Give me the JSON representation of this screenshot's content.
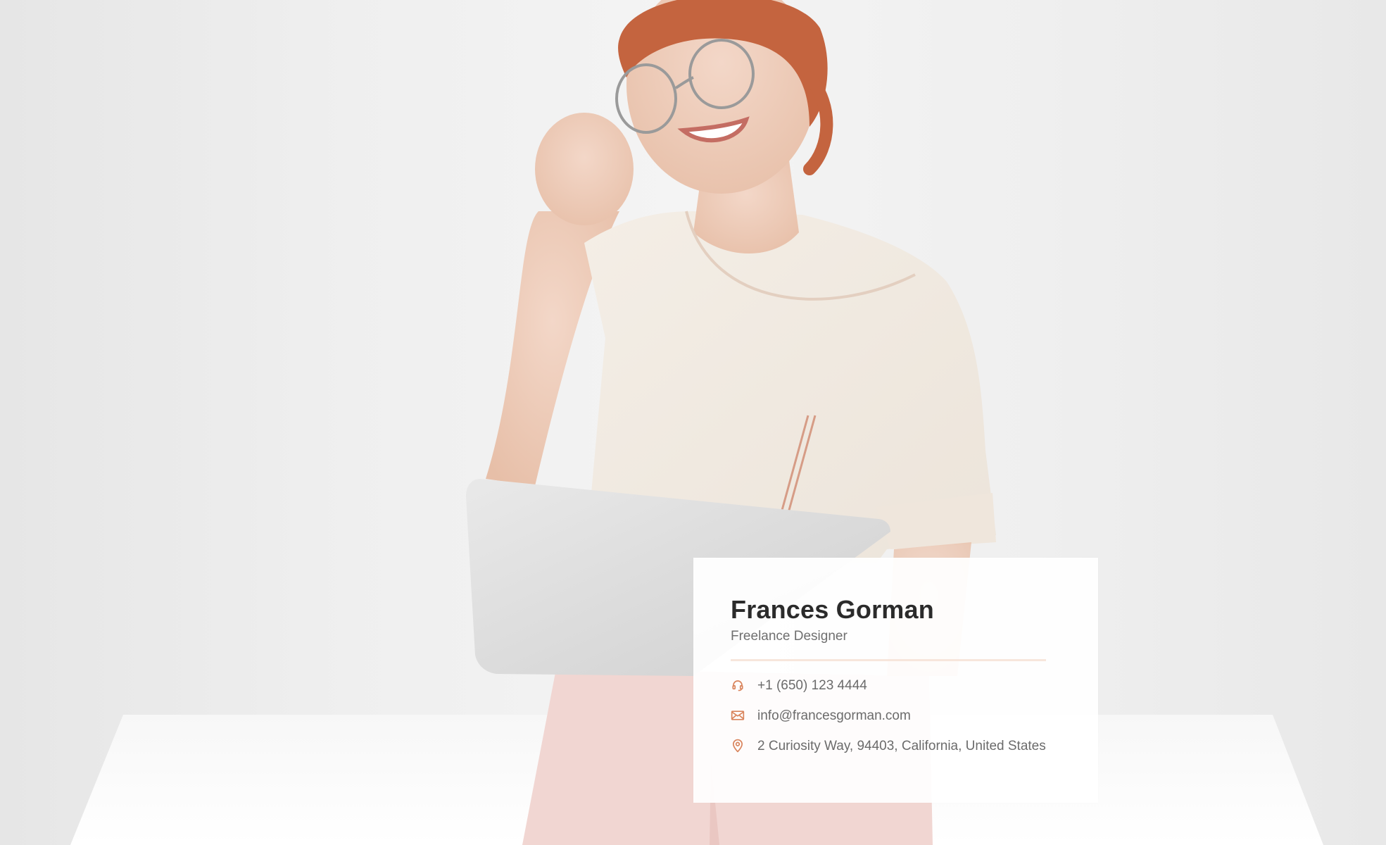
{
  "profile": {
    "name": "Frances Gorman",
    "role": "Freelance Designer"
  },
  "contacts": [
    {
      "icon": "headset-icon",
      "text": "+1 (650) 123 4444"
    },
    {
      "icon": "envelope-icon",
      "text": "info@francesgorman.com"
    },
    {
      "icon": "location-pin-icon",
      "text": "2 Curiosity Way, 94403, California, United States"
    }
  ],
  "colors": {
    "accent": "#d9845c",
    "divider": "#f7e6dc",
    "name_text": "#2b2b2b",
    "muted_text": "#6b6b6b"
  }
}
